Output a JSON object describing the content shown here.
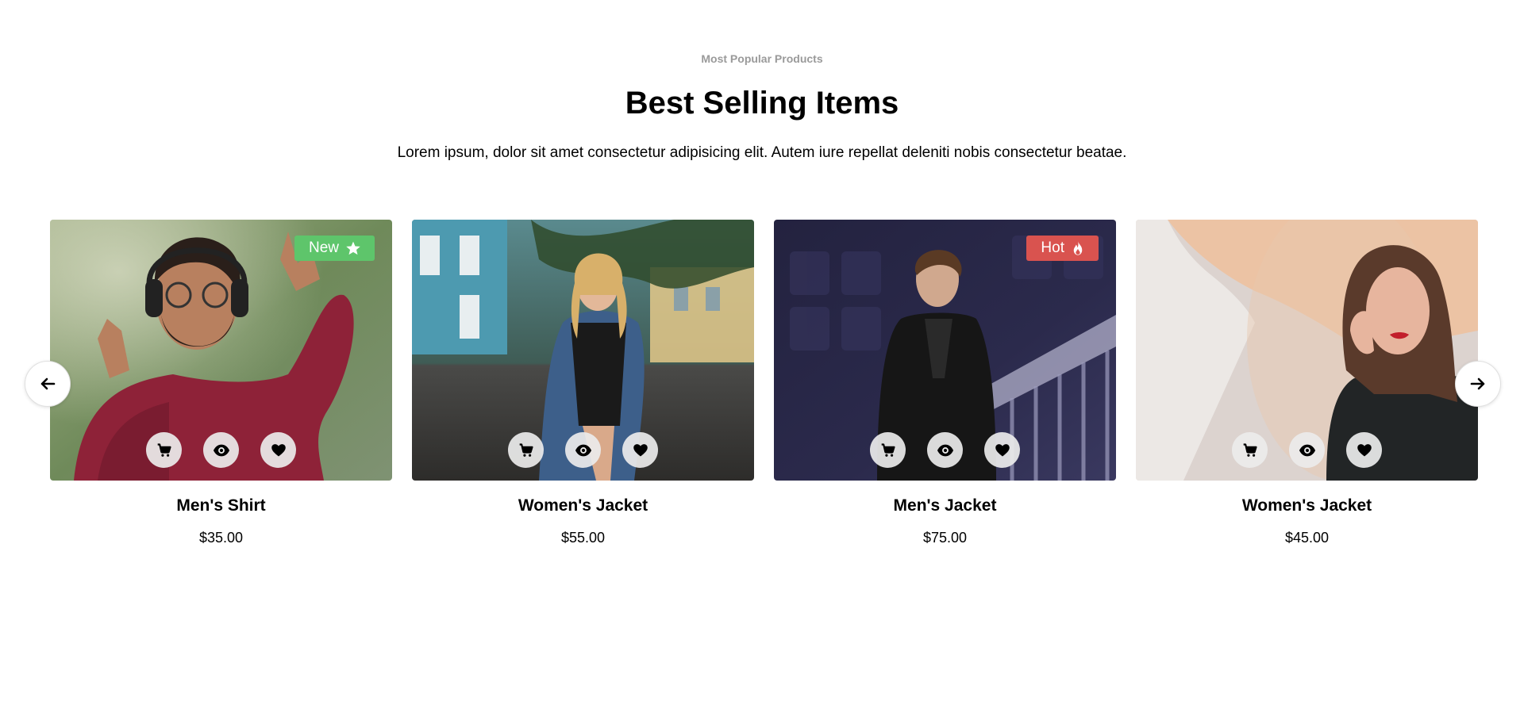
{
  "header": {
    "eyebrow": "Most Popular Products",
    "title": "Best Selling Items",
    "subtitle": "Lorem ipsum, dolor sit amet consectetur adipisicing elit. Autem iure repellat deleniti nobis consectetur beatae."
  },
  "carousel": {
    "prev_icon": "arrow-left-icon",
    "next_icon": "arrow-right-icon"
  },
  "products": [
    {
      "name": "Men's Shirt",
      "price": "$35.00",
      "badge": "New",
      "badge_icon": "star-icon",
      "badge_color": "#5ec56b"
    },
    {
      "name": "Women's Jacket",
      "price": "$55.00",
      "badge": "",
      "badge_icon": "",
      "badge_color": ""
    },
    {
      "name": "Men's Jacket",
      "price": "$75.00",
      "badge": "Hot",
      "badge_icon": "fire-icon",
      "badge_color": "#d9534f"
    },
    {
      "name": "Women's Jacket",
      "price": "$45.00",
      "badge": "",
      "badge_icon": "",
      "badge_color": ""
    }
  ],
  "card_actions": [
    "cart-icon",
    "eye-icon",
    "heart-icon"
  ]
}
